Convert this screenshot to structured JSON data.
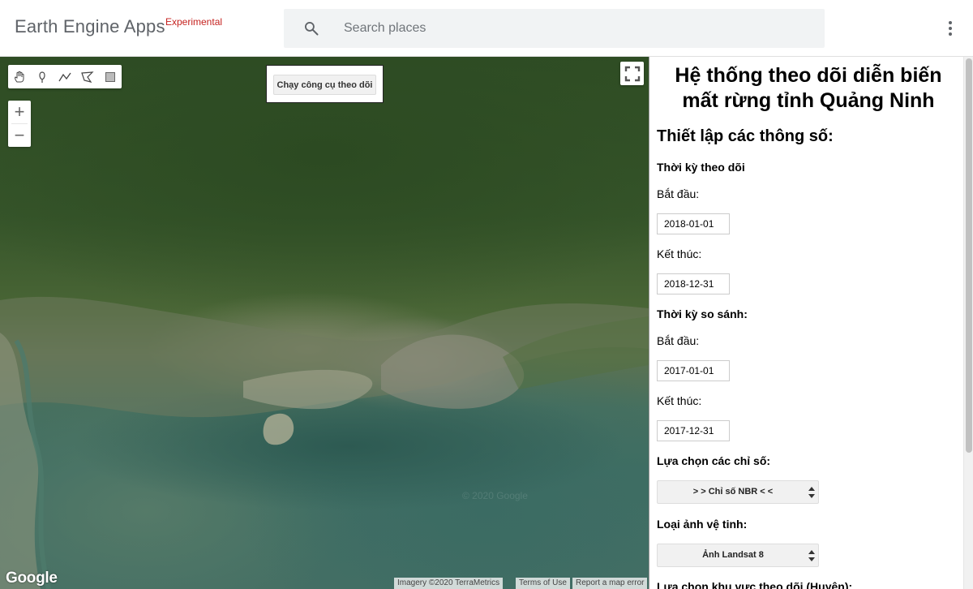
{
  "header": {
    "brand": "Earth Engine Apps",
    "brand_tag": "Experimental",
    "search_placeholder": "Search places"
  },
  "map": {
    "run_button_label": "Chạy công cụ theo dõi",
    "zoom_in": "+",
    "zoom_out": "−",
    "google_logo": "Google",
    "imagery_credit": "Imagery ©2020 TerraMetrics",
    "terms": "Terms of Use",
    "report": "Report a map error",
    "drawing_tools": [
      "hand-icon",
      "marker-icon",
      "polyline-icon",
      "polygon-icon",
      "rectangle-icon"
    ]
  },
  "panel": {
    "title": "Hệ thống theo dõi diễn biến mất rừng tỉnh Quảng Ninh",
    "settings_heading": "Thiết lập các thông số:",
    "monitor_period_label": "Thời kỳ theo dõi",
    "start_label": "Bắt đầu:",
    "end_label": "Kết thúc:",
    "monitor_start": "2018-01-01",
    "monitor_end": "2018-12-31",
    "compare_period_label": "Thời kỳ so sánh:",
    "compare_start": "2017-01-01",
    "compare_end": "2017-12-31",
    "index_label": "Lựa chọn các chỉ số:",
    "index_value": "> > Chỉ số NBR < <",
    "satellite_label": "Loại ảnh vệ tinh:",
    "satellite_value": "Ảnh Landsat 8",
    "district_label": "Lựa chọn khu vực theo dõi (Huyện):"
  }
}
